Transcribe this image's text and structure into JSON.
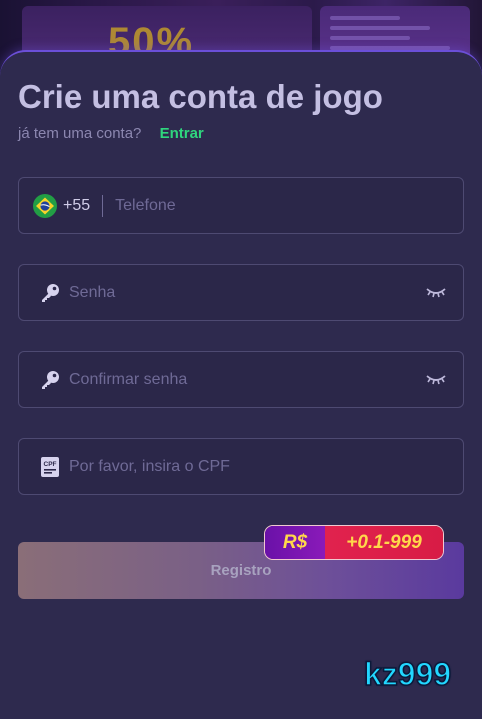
{
  "page": {
    "title": "Crie uma conta de jogo",
    "subtitle": "já tem uma conta?",
    "login_link": "Entrar"
  },
  "phone": {
    "country_code": "+55",
    "placeholder": "Telefone",
    "flag": "brazil-flag-icon"
  },
  "password": {
    "placeholder": "Senha",
    "icon": "key-icon",
    "toggle_icon": "eye-closed-icon"
  },
  "confirm_password": {
    "placeholder": "Confirmar senha",
    "icon": "key-icon",
    "toggle_icon": "eye-closed-icon"
  },
  "cpf": {
    "placeholder": "Por favor, insira o CPF",
    "icon": "cpf-card-icon",
    "icon_text": "CPF"
  },
  "register": {
    "label": "Registro"
  },
  "bonus": {
    "currency": "R$",
    "amount": "+0.1-999"
  },
  "brand": {
    "name": "kz999"
  },
  "colors": {
    "accent_green": "#2fd67e",
    "sheet_bg": "#2e2a4e",
    "brand_cyan": "#22d7ff",
    "bonus_red": "#e1224e",
    "bonus_purple": "#7a14b0"
  }
}
